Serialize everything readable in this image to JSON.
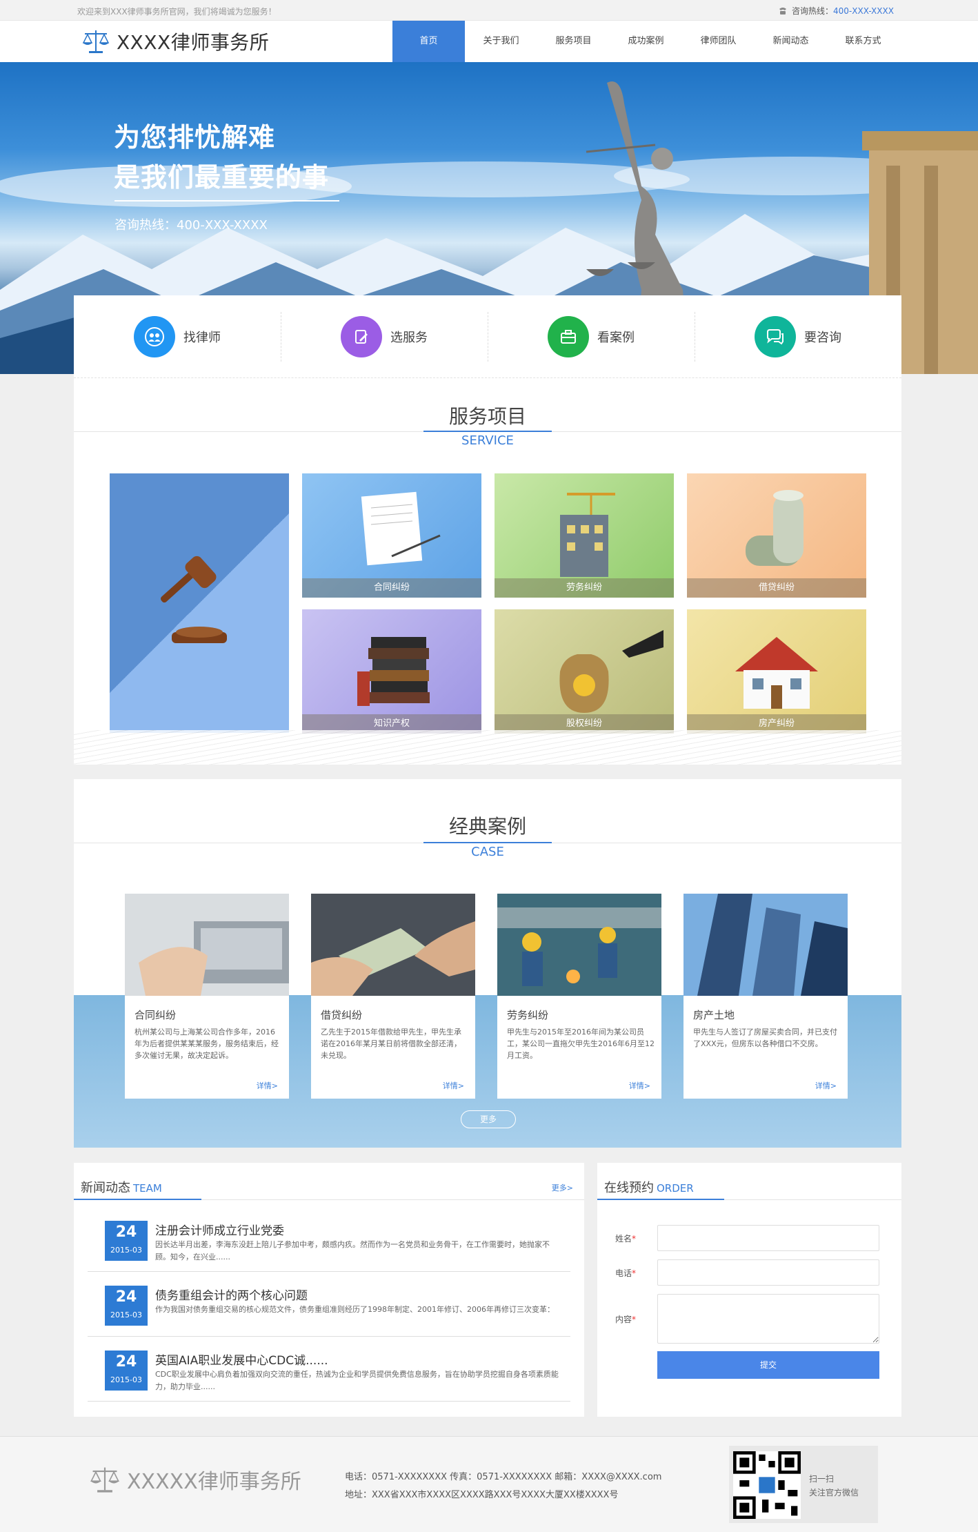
{
  "topbar": {
    "welcome": "欢迎来到XXX律师事务所官网，我们将竭诚为您服务！",
    "hotline_label": "咨询热线：",
    "hotline": "400-XXX-XXXX"
  },
  "header": {
    "logo_text": "XXXX律师事务所"
  },
  "nav": [
    "首页",
    "关于我们",
    "服务项目",
    "成功案例",
    "律师团队",
    "新闻动态",
    "联系方式"
  ],
  "banner": {
    "line1": "为您排忧解难",
    "line2": "是我们最重要的事",
    "tel": "咨询热线：400-XXX-XXXX"
  },
  "features": [
    {
      "label": "找律师",
      "icon": "people-icon",
      "color": "#2196f3"
    },
    {
      "label": "选服务",
      "icon": "edit-icon",
      "color": "#9b5de5"
    },
    {
      "label": "看案例",
      "icon": "briefcase-icon",
      "color": "#21b24b"
    },
    {
      "label": "要咨询",
      "icon": "chat-icon",
      "color": "#0fb59a"
    }
  ],
  "service": {
    "title": "服务项目",
    "sub": "SERVICE",
    "items": [
      "合同纠纷",
      "劳务纠纷",
      "借贷纠纷",
      "知识产权",
      "股权纠纷",
      "房产纠纷"
    ]
  },
  "cases": {
    "title": "经典案例",
    "sub": "CASE",
    "more": "更多",
    "detail": "详情>",
    "items": [
      {
        "title": "合同纠纷",
        "desc": "杭州某公司与上海某公司合作多年，2016年为后者提供某某某服务，服务结束后，经多次催讨无果，故决定起诉。"
      },
      {
        "title": "借贷纠纷",
        "desc": "乙先生于2015年借款给甲先生，甲先生承诺在2016年某月某日前将借款全部还清，未兑现。"
      },
      {
        "title": "劳务纠纷",
        "desc": "甲先生与2015年至2016年间为某公司员工，某公司一直拖欠甲先生2016年6月至12月工资。"
      },
      {
        "title": "房产土地",
        "desc": "甲先生与人签订了房屋买卖合同，并已支付了XXX元，但房东以各种借口不交房。"
      }
    ]
  },
  "news": {
    "title": "新闻动态",
    "sub": "TEAM",
    "more": "更多>",
    "items": [
      {
        "day": "24",
        "ym": "2015-03",
        "title": "注册会计师成立行业党委",
        "desc": "因长达半月出差，李海东没赶上陪儿子参加中考，颇感内疚。然而作为一名党员和业务骨干，在工作需要时，她抛家不顾。知今，在兴业......"
      },
      {
        "day": "24",
        "ym": "2015-03",
        "title": "债务重组会计的两个核心问题",
        "desc": "作为我国对债务重组交易的核心规范文件，债务重组准则经历了1998年制定、2001年修订、2006年再修订三次变革："
      },
      {
        "day": "24",
        "ym": "2015-03",
        "title": "英国AIA职业发展中心CDC诚......",
        "desc": "CDC职业发展中心肩负着加强双向交流的重任，热诚为企业和学员提供免费信息服务，旨在协助学员挖掘自身各项素质能力，助力毕业......"
      }
    ]
  },
  "order": {
    "title": "在线预约",
    "sub": "ORDER",
    "name": "姓名",
    "phone": "电话",
    "content": "内容",
    "submit": "提交"
  },
  "footer": {
    "logo_text": "XXXXX律师事务所",
    "line1": "电话：0571-XXXXXXXX  传真：0571-XXXXXXXX  邮箱：XXXX@XXXX.com",
    "line2": "地址：XXX省XXX市XXXX区XXXX路XXX号XXXX大厦XX楼XXXX号",
    "qr1": "扫一扫",
    "qr2": "关注官方微信"
  }
}
